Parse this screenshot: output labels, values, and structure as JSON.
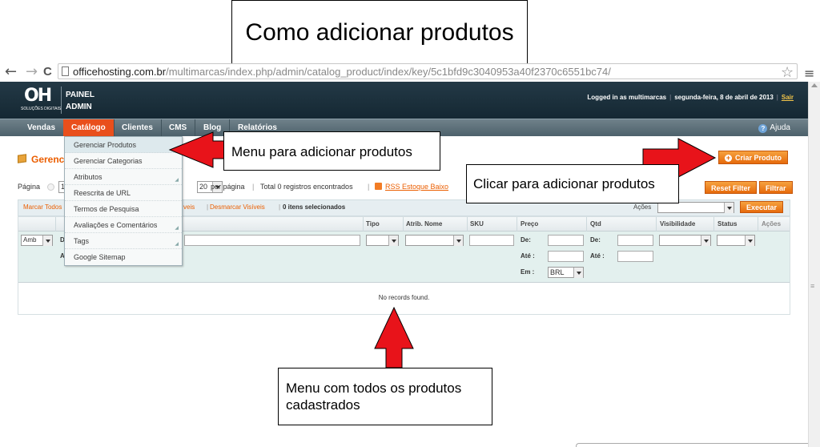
{
  "annotation": {
    "title": "Como adicionar produtos",
    "callout_menu": "Menu para adicionar produtos",
    "callout_button": "Clicar para adicionar produtos",
    "callout_grid": "Menu com todos os produtos cadastrados"
  },
  "browser": {
    "back": "←",
    "forward": "→",
    "reload": "C",
    "url_host": "officehosting.com.br",
    "url_path": "/multimarcas/index.php/admin/catalog_product/index/key/5c1bfd9c3040953a40f2370c6551bc74/",
    "star": "☆",
    "menu": "≡"
  },
  "header": {
    "logo_text": "OH",
    "logo_sub": "SOLUÇÕES DIGITAIS",
    "panel_line1": "PAINEL",
    "panel_line2": "ADMIN",
    "logged_in": "Logged in as multimarcas",
    "date": "segunda-feira, 8 de abril de 2013",
    "logout": "Sair",
    "separator": "|"
  },
  "nav": {
    "items": [
      "Vendas",
      "Catálogo",
      "Clientes",
      "CMS",
      "Blog",
      "Relatórios"
    ],
    "help": "Ajuda",
    "active_index": 1
  },
  "catalog_menu": {
    "items": [
      {
        "label": "Gerenciar Produtos",
        "submenu": false
      },
      {
        "label": "Gerenciar Categorias",
        "submenu": false
      },
      {
        "label": "Atributos",
        "submenu": true
      },
      {
        "label": "Reescrita de URL",
        "submenu": false
      },
      {
        "label": "Termos de Pesquisa",
        "submenu": false
      },
      {
        "label": "Avaliações e Comentários",
        "submenu": true
      },
      {
        "label": "Tags",
        "submenu": true
      },
      {
        "label": "Google Sitemap",
        "submenu": false
      }
    ]
  },
  "page": {
    "title_visible": "Gerenc",
    "add_button": "Criar Produto",
    "reset_button": "Reset Filter",
    "filter_button": "Filtrar"
  },
  "pager": {
    "page_label": "Página",
    "page_value": "1",
    "per_page_value": "20",
    "per_page_label": "por página",
    "total": "Total 0 registros encontrados",
    "rss": "RSS Estoque Baixo"
  },
  "massaction": {
    "select_all": "Marcar Todos",
    "visible_partial": "veis",
    "unselect_visible": "Desmarcar Visíveis",
    "selected": "0 itens selecionados",
    "actions_label": "Ações",
    "execute": "Executar"
  },
  "grid": {
    "columns": [
      "Tipo",
      "Atrib. Nome",
      "SKU",
      "Preço",
      "Qtd",
      "Visibilidade",
      "Status",
      "Ações"
    ],
    "store_select": "Amb",
    "partial_col_letter": "D",
    "partial_row_letter": "A",
    "from_label": "De:",
    "to_label": "Até :",
    "currency_label": "Em :",
    "currency_value": "BRL",
    "empty_message": "No records found."
  }
}
